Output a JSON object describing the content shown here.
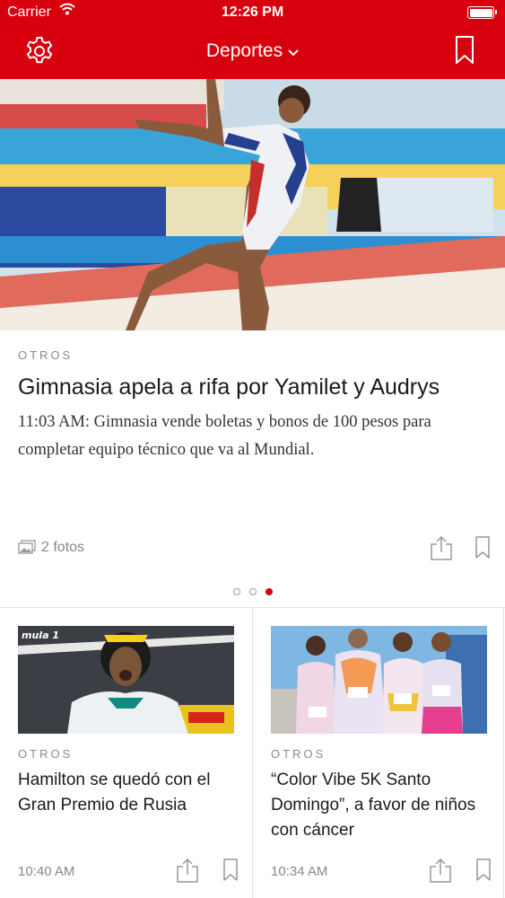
{
  "status_bar": {
    "carrier": "Carrier",
    "time": "12:26 PM",
    "icons": [
      "wifi-icon",
      "battery-icon"
    ]
  },
  "nav": {
    "section": "Deportes",
    "icons": [
      "gear-icon",
      "chevron-down-icon",
      "bookmark-icon"
    ]
  },
  "colors": {
    "brand_red": "#d9000d",
    "muted_text": "#888888",
    "divider": "#e3e3e3"
  },
  "hero": {
    "category": "OTROS",
    "title": "Gimnasia apela a rifa por Yamilet y Audrys",
    "summary": "11:03 AM: Gimnasia vende boletas y bonos de 100 pesos para completar equipo técnico que va al Mundial.",
    "photos_label": "2 fotos",
    "icons": [
      "photos-icon",
      "share-icon",
      "bookmark-icon"
    ]
  },
  "pager": {
    "count": 3,
    "active_index": 2
  },
  "cards": [
    {
      "category": "OTROS",
      "title": "Hamilton se quedó con el Gran Premio de Rusia",
      "time": "10:40 AM",
      "image_text": "mula 1"
    },
    {
      "category": "OTROS",
      "title": "“Color Vibe 5K Santo Domingo”, a favor de niños con cáncer",
      "time": "10:34 AM"
    }
  ]
}
